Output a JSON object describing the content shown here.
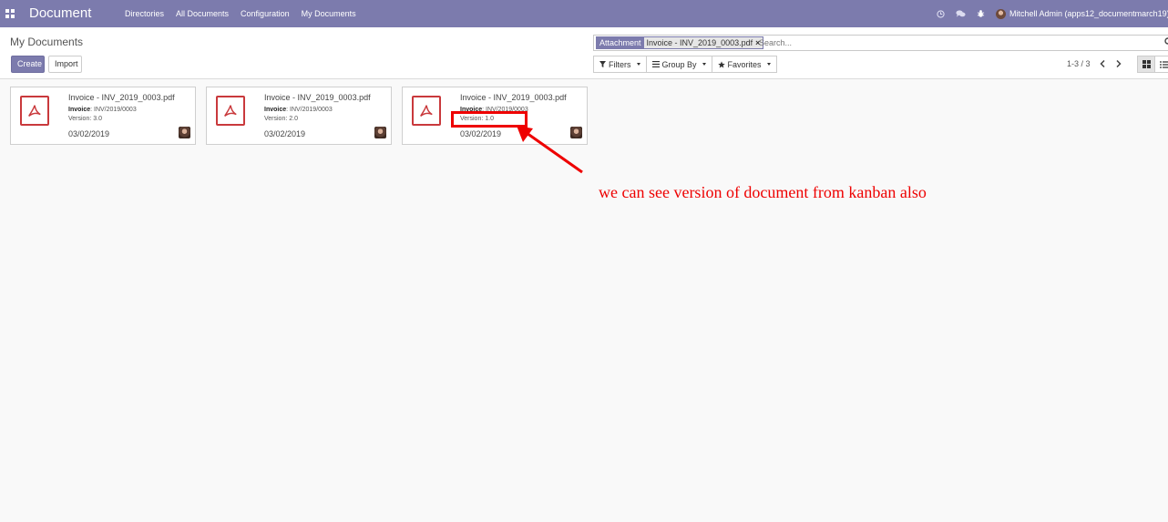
{
  "navbar": {
    "brand": "Document",
    "menu": [
      "Directories",
      "All Documents",
      "Configuration",
      "My Documents"
    ],
    "user_name": "Mitchell Admin (apps12_documentmarch19)",
    "icons": [
      "clock-icon",
      "chat-icon",
      "bug-icon"
    ],
    "color": "#7c7bad"
  },
  "control_panel": {
    "breadcrumb": "My Documents",
    "create_label": "Create",
    "import_label": "Import",
    "search": {
      "facet_label": "Attachment",
      "facet_value": "Invoice - INV_2019_0003.pdf",
      "placeholder": "Search..."
    },
    "filters_label": "Filters",
    "groupby_label": "Group By",
    "favorites_label": "Favorites",
    "pager": "1-3 / 3"
  },
  "cards": [
    {
      "title": "Invoice - INV_2019_0003.pdf",
      "invoice_label": "Invoice",
      "invoice_value": ": INV/2019/0003",
      "version": "Version: 3.0",
      "date": "03/02/2019"
    },
    {
      "title": "Invoice - INV_2019_0003.pdf",
      "invoice_label": "Invoice",
      "invoice_value": ": INV/2019/0003",
      "version": "Version: 2.0",
      "date": "03/02/2019"
    },
    {
      "title": "Invoice - INV_2019_0003.pdf",
      "invoice_label": "Invoice",
      "invoice_value": ": INV/2019/0003",
      "version": "Version: 1.0",
      "date": "03/02/2019"
    }
  ],
  "annotation": {
    "text": "we can see version of document from kanban also",
    "color": "#ee0000"
  }
}
